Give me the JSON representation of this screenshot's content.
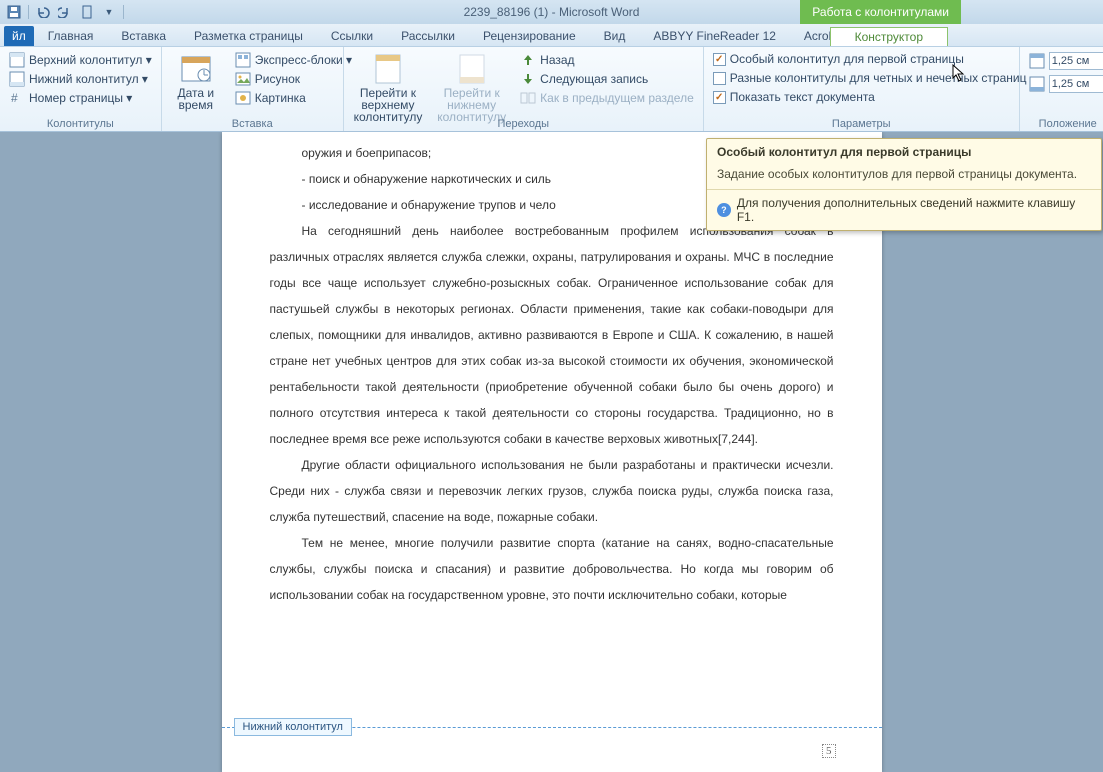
{
  "title": "2239_88196 (1)  -  Microsoft Word",
  "context_tab": "Работа с колонтитулами",
  "tabs": {
    "file": "йл",
    "list": [
      "Главная",
      "Вставка",
      "Разметка страницы",
      "Ссылки",
      "Рассылки",
      "Рецензирование",
      "Вид",
      "ABBYY FineReader 12",
      "Acrobat"
    ],
    "context": "Конструктор"
  },
  "ribbon": {
    "g1": {
      "label": "Колонтитулы",
      "top_hdr": "Верхний колонтитул ▾",
      "bot_hdr": "Нижний колонтитул ▾",
      "pagenum": "Номер страницы ▾"
    },
    "g2": {
      "label": "Вставка",
      "datetime": "Дата и время",
      "express": "Экспресс-блоки ▾",
      "picture": "Рисунок",
      "clipart": "Картинка"
    },
    "g3": {
      "label": "Переходы",
      "goto_top": "Перейти к верхнему колонтитулу",
      "goto_bot": "Перейти к нижнему колонтитулу",
      "back": "Назад",
      "next": "Следующая запись",
      "prev_section": "Как в предыдущем разделе"
    },
    "g4": {
      "label": "Параметры",
      "first_page": "Особый колонтитул для первой страницы",
      "odd_even": "Разные колонтитулы для четных и нечетных страниц",
      "show_doc": "Показать текст документа"
    },
    "g5": {
      "label": "Положение",
      "val_top": "1,25 см",
      "val_bot": "1,25 см"
    }
  },
  "tooltip": {
    "title": "Особый колонтитул для первой страницы",
    "body": "Задание особых колонтитулов для первой страницы документа.",
    "f1": "Для получения дополнительных сведений нажмите клавишу F1."
  },
  "document": {
    "lines": [
      "оружия и боеприпасов;",
      "- поиск и обнаружение наркотических и силь",
      "- исследование и обнаружение трупов и чело",
      "На сегодняшний день наиболее востребованным профилем использования собак в различных отраслях является служба слежки, охраны, патрулирования и охраны. МЧС в последние годы все чаще использует служебно-розыскных собак. Ограниченное использование собак для пастушьей службы в некоторых регионах. Области применения, такие как собаки-поводыри для слепых, помощники для инвалидов, активно развиваются в Европе и США. К сожалению, в нашей стране нет учебных центров для этих собак из-за высокой стоимости их обучения, экономической рентабельности такой деятельности (приобретение обученной собаки было бы очень дорого) и полного отсутствия интереса к такой деятельности со стороны государства. Традиционно, но в последнее время все реже используются собаки в качестве верховых животных[7,244].",
      "Другие области официального использования не были разработаны и практически исчезли. Среди них - служба связи и перевозчик легких грузов, служба поиска руды, служба поиска газа, служба путешествий, спасение на воде, пожарные собаки.",
      "Тем не менее, многие получили развитие спорта (катание на санях, водно-спасательные службы, службы поиска и спасания) и развитие добровольчества. Но когда мы говорим об использовании собак на государственном уровне, это почти исключительно собаки, которые"
    ],
    "footer_tag": "Нижний колонтитул",
    "page_num": "5"
  }
}
